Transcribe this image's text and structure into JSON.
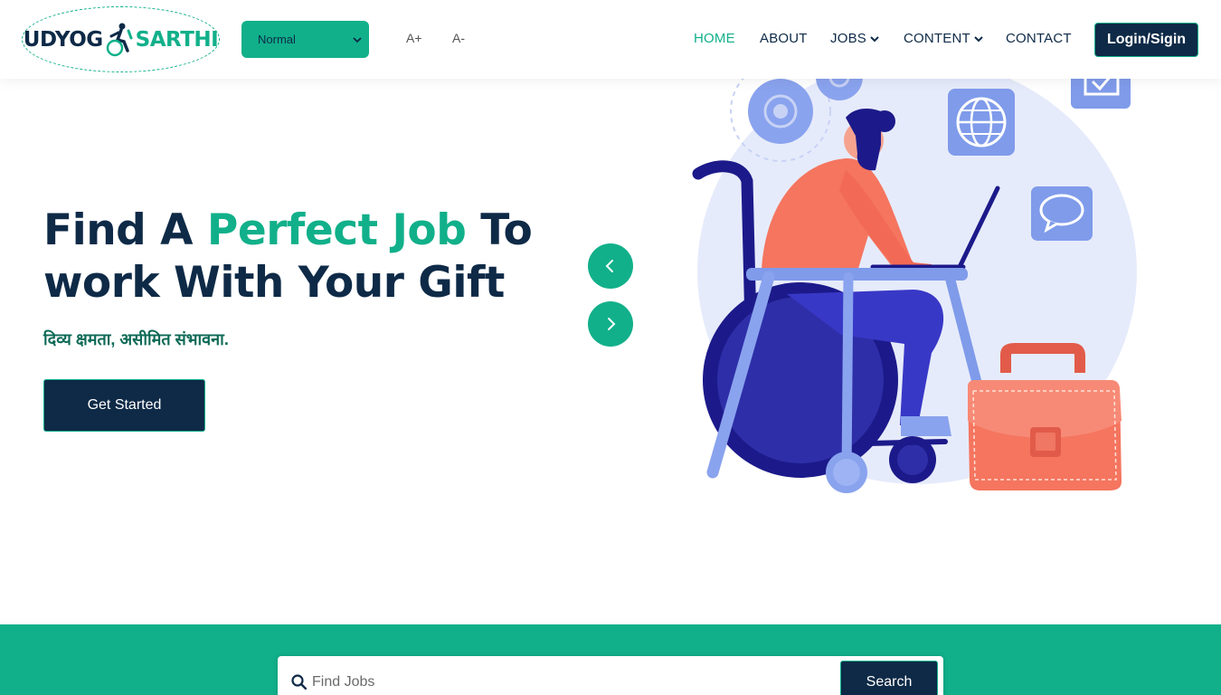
{
  "header": {
    "logo": {
      "part1": "UDYOG",
      "part2": "SARTHI",
      "icon": "wheelchair-person-icon"
    },
    "font_mode_select": {
      "selected": "Normal"
    },
    "font_increase": "A+",
    "font_decrease": "A-",
    "nav": {
      "home": "HOME",
      "about": "ABOUT",
      "jobs": "JOBS",
      "content": "CONTENT",
      "contact": "CONTACT"
    },
    "login_label": "Login/Sigin"
  },
  "hero": {
    "title_part1": "Find A ",
    "title_highlight": "Perfect Job",
    "title_part2": " To",
    "title_line2": "work With Your Gift",
    "subtitle": "दिव्य क्षमता, असीमित संभावना.",
    "cta_label": "Get Started",
    "prev_icon": "chevron-left-icon",
    "next_icon": "chevron-right-icon",
    "illustration": "person-in-wheelchair-working-on-laptop"
  },
  "search": {
    "placeholder": "Find Jobs",
    "button_label": "Search"
  },
  "colors": {
    "primary_green": "#11b08a",
    "navy": "#0e2a47",
    "coral": "#f5755f",
    "indigo": "#2e2ea8",
    "light_blue": "#e6ebfb"
  }
}
